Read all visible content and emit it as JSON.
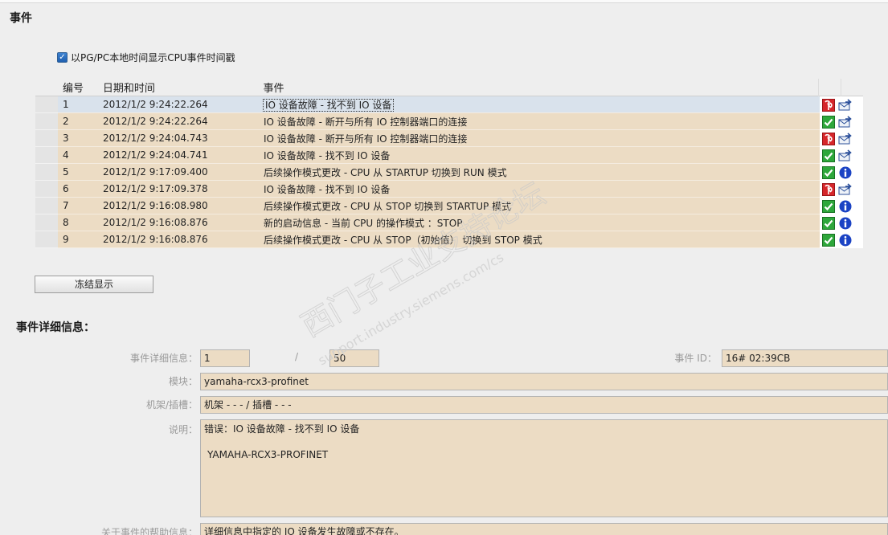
{
  "section": {
    "title": "事件"
  },
  "checkbox": {
    "label": "以PG/PC本地时间显示CPU事件时间戳",
    "checked": true
  },
  "table": {
    "headers": {
      "num": "编号",
      "datetime": "日期和时间",
      "event": "事件"
    },
    "rows": [
      {
        "num": "1",
        "datetime": "2012/1/2 9:24:22.264",
        "event": "IO 设备故障 - 找不到 IO 设备",
        "icon1": "error-wrench-icon",
        "icon2": "outgoing-event-icon",
        "selected": true
      },
      {
        "num": "2",
        "datetime": "2012/1/2 9:24:22.264",
        "event": "IO 设备故障 - 断开与所有 IO 控制器端口的连接",
        "icon1": "ok-check-icon",
        "icon2": "outgoing-event-icon"
      },
      {
        "num": "3",
        "datetime": "2012/1/2 9:24:04.743",
        "event": "IO 设备故障 - 断开与所有 IO 控制器端口的连接",
        "icon1": "error-wrench-icon",
        "icon2": "outgoing-event-icon"
      },
      {
        "num": "4",
        "datetime": "2012/1/2 9:24:04.741",
        "event": "IO 设备故障 - 找不到 IO 设备",
        "icon1": "ok-check-icon",
        "icon2": "outgoing-event-icon"
      },
      {
        "num": "5",
        "datetime": "2012/1/2 9:17:09.400",
        "event": "后续操作模式更改  - CPU 从 STARTUP 切换到 RUN 模式",
        "icon1": "ok-check-icon",
        "icon2": "info-icon"
      },
      {
        "num": "6",
        "datetime": "2012/1/2 9:17:09.378",
        "event": "IO 设备故障 - 找不到 IO 设备",
        "icon1": "error-wrench-icon",
        "icon2": "outgoing-event-icon"
      },
      {
        "num": "7",
        "datetime": "2012/1/2 9:16:08.980",
        "event": "后续操作模式更改  - CPU 从 STOP 切换到 STARTUP 模式",
        "icon1": "ok-check-icon",
        "icon2": "info-icon"
      },
      {
        "num": "8",
        "datetime": "2012/1/2 9:16:08.876",
        "event": "新的启动信息 - 当前 CPU 的操作模式 ：STOP",
        "icon1": "ok-check-icon",
        "icon2": "info-icon"
      },
      {
        "num": "9",
        "datetime": "2012/1/2 9:16:08.876",
        "event": "后续操作模式更改  - CPU 从 STOP（初始值） 切换到 STOP 模式",
        "icon1": "ok-check-icon",
        "icon2": "info-icon"
      }
    ]
  },
  "freeze_button": {
    "label": "冻结显示"
  },
  "details": {
    "title": "事件详细信息：",
    "detail_label": "事件详细信息：",
    "detail_index": "1",
    "detail_separator": "/",
    "detail_total": "50",
    "event_id_label": "事件 ID：",
    "event_id_value": "16# 02:39CB",
    "module_label": "模块：",
    "module_value": "yamaha-rcx3-profinet",
    "rack_label": "机架/插槽：",
    "rack_value": "机架 - - - / 插槽 - - -",
    "desc_label": "说明：",
    "desc_line1": "错误：IO 设备故障 - 找不到 IO 设备",
    "desc_line2": "YAMAHA-RCX3-PROFINET",
    "help_label": "关于事件的帮助信息：",
    "help_value": "详细信息中指定的 IO 设备发生故障或不存在。"
  },
  "watermark": {
    "line1": "西门子工业支持论坛",
    "line2": "support.industry.siemens.com/cs"
  },
  "colors": {
    "row_bg": "#ecdcc4",
    "selected_bg": "#d9e2ec",
    "error_red": "#d6262b",
    "ok_green": "#2ea73b",
    "info_blue": "#1b43c4"
  }
}
